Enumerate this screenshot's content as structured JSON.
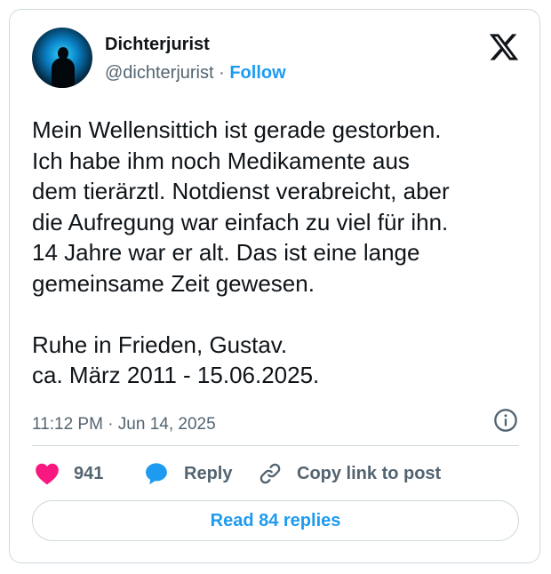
{
  "author": {
    "name": "Dichterjurist",
    "handle": "@dichterjurist",
    "separator": " · ",
    "follow_label": "Follow",
    "avatar_icon": "avatar-silhouette"
  },
  "brand": {
    "logo_icon": "x-logo-icon",
    "color": "#0f1419"
  },
  "tweet": {
    "text": "Mein Wellensittich ist gerade gestorben.\nIch habe ihm noch Medikamente aus\ndem tierärztl. Notdienst verabreicht, aber\ndie Aufregung war einfach zu viel für ihn.\n14 Jahre war er alt. Das ist eine lange\ngemeinsame Zeit gewesen.\n\nRuhe in Frieden, Gustav.\nca. März 2011 - 15.06.2025.",
    "timestamp": "11:12 PM · Jun 14, 2025"
  },
  "actions": {
    "like_count": "941",
    "reply_label": "Reply",
    "copy_label": "Copy link to post"
  },
  "read_replies_label": "Read 84 replies",
  "colors": {
    "accent": "#1d9bf0",
    "like": "#f91880",
    "muted": "#536471",
    "border": "#cfd9de"
  }
}
